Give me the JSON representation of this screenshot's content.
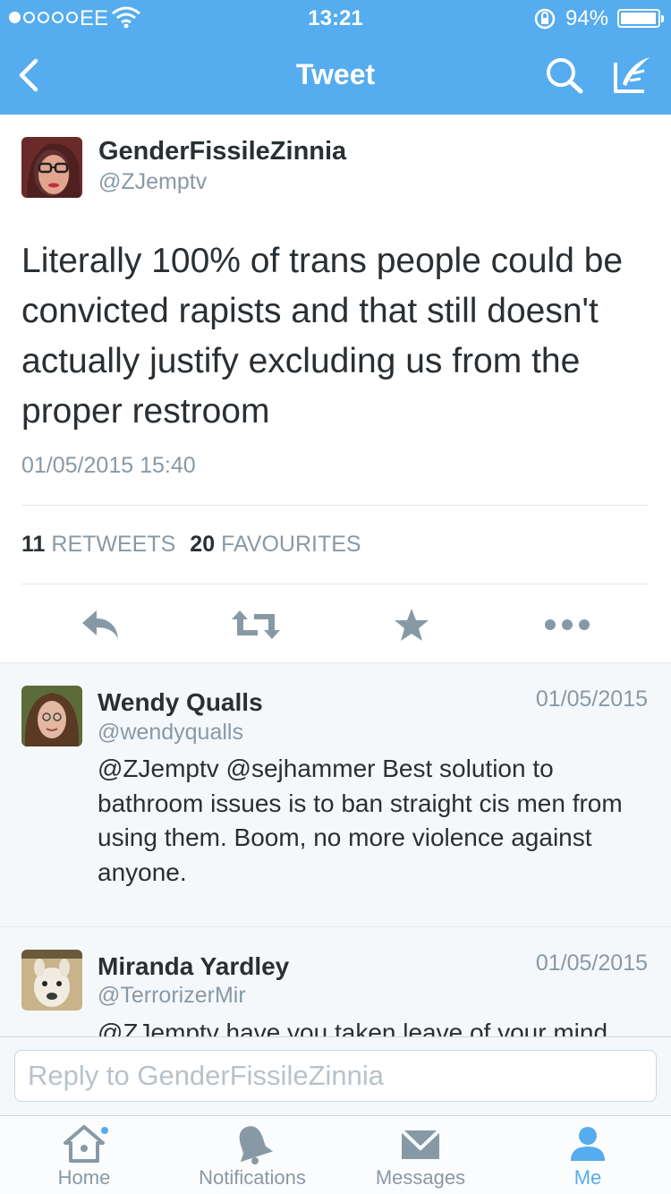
{
  "status_bar": {
    "carrier": "EE",
    "time": "13:21",
    "battery_percent": "94%"
  },
  "nav": {
    "title": "Tweet"
  },
  "tweet": {
    "author_name": "GenderFissileZinnia",
    "author_handle": "@ZJemptv",
    "text": "Literally 100% of trans people could be convicted rapists and that still doesn't actually justify excluding us from the proper restroom",
    "timestamp": "01/05/2015 15:40",
    "retweets_count": "11",
    "retweets_label": "RETWEETS",
    "favourites_count": "20",
    "favourites_label": "FAVOURITES"
  },
  "replies": [
    {
      "name": "Wendy Qualls",
      "handle": "@wendyqualls",
      "date": "01/05/2015",
      "text": "@ZJemptv @sejhammer Best solution to bathroom issues is to ban straight cis men from using them.  Boom, no more violence against anyone."
    },
    {
      "name": "Miranda Yardley",
      "handle": "@TerrorizerMir",
      "date": "01/05/2015",
      "text": "@ZJemptv have you taken leave of your mind"
    }
  ],
  "reply_box": {
    "placeholder": "Reply to GenderFissileZinnia"
  },
  "tabs": [
    {
      "label": "Home",
      "icon": "home-icon"
    },
    {
      "label": "Notifications",
      "icon": "bell-icon"
    },
    {
      "label": "Messages",
      "icon": "envelope-icon"
    },
    {
      "label": "Me",
      "icon": "person-icon"
    }
  ],
  "colors": {
    "brand": "#55acee",
    "text": "#292f33",
    "secondary": "#8899a6",
    "divider": "#e1e8ed"
  }
}
